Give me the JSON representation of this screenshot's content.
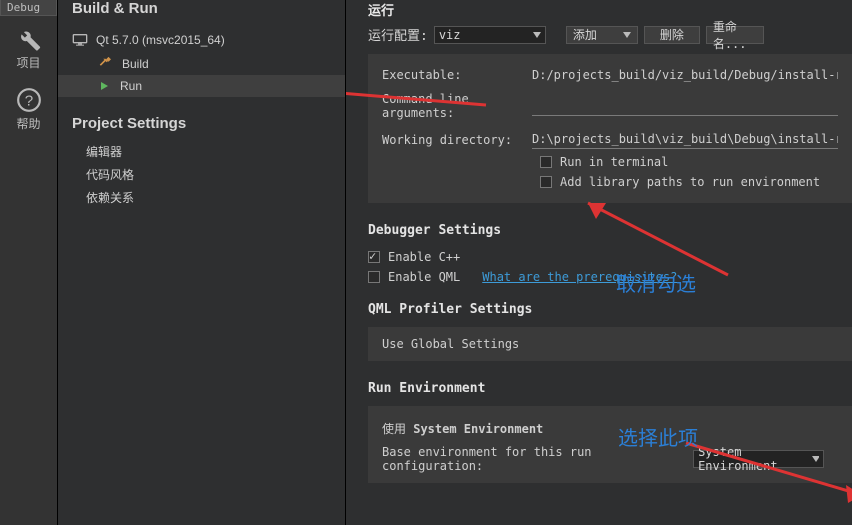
{
  "rail": {
    "debug_tab": "Debug",
    "project_label": "项目",
    "help_label": "帮助"
  },
  "sidebar": {
    "head": "Build & Run",
    "kit": "Qt 5.7.0 (msvc2015_64)",
    "build": "Build",
    "run": "Run",
    "section": "Project Settings",
    "items": [
      "编辑器",
      "代码风格",
      "依赖关系"
    ]
  },
  "run": {
    "title": "运行",
    "config_label": "运行配置:",
    "config_value": "viz",
    "btn_add": "添加",
    "btn_del": "删除",
    "btn_rename": "重命名..."
  },
  "form": {
    "exe_label": "Executable:",
    "exe_value": "D:/projects_build/viz_build/Debug/install-root",
    "args_label": "Command line arguments:",
    "args_value": "",
    "wd_label": "Working directory:",
    "wd_value": "D:\\projects_build\\viz_build\\Debug\\install-root",
    "run_in_terminal": "Run in terminal",
    "add_lib": "Add library paths to run environment"
  },
  "debugger": {
    "title": "Debugger Settings",
    "enable_cpp": "Enable C++",
    "enable_qml": "Enable QML",
    "prereq_link": "What are the prerequisites?"
  },
  "qml": {
    "title": "QML Profiler Settings",
    "use_global": "Use Global Settings"
  },
  "env": {
    "title": "Run Environment",
    "use_prefix": "使用 ",
    "use_value": "System Environment",
    "base_label": "Base environment for this run configuration:",
    "combo_value": "System Environment"
  },
  "anno": {
    "cancel": "取消勾选",
    "select": "选择此项"
  }
}
